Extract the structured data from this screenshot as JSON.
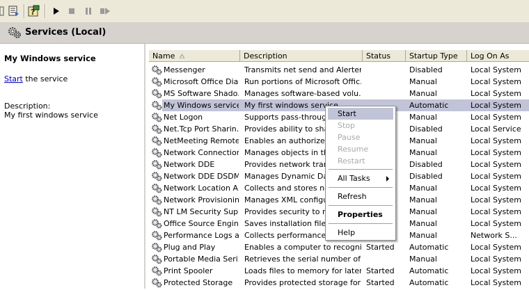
{
  "header": {
    "title": "Services (Local)"
  },
  "left_pane": {
    "service_name": "My Windows service",
    "start_link": "Start",
    "start_suffix": " the service",
    "description_label": "Description:",
    "description_value": "My first windows service"
  },
  "columns": [
    "Name",
    "Description",
    "Status",
    "Startup Type",
    "Log On As"
  ],
  "rows": [
    {
      "name": "Messenger",
      "desc": "Transmits net send and Alerter ...",
      "status": "",
      "type": "Disabled",
      "logon": "Local System"
    },
    {
      "name": "Microsoft Office Dia...",
      "desc": "Run portions of Microsoft Offic...",
      "status": "",
      "type": "Manual",
      "logon": "Local System"
    },
    {
      "name": "MS Software Shado...",
      "desc": "Manages software-based volu...",
      "status": "",
      "type": "Manual",
      "logon": "Local System"
    },
    {
      "name": "My Windows service",
      "desc": "My first windows service",
      "status": "",
      "type": "Automatic",
      "logon": "Local System"
    },
    {
      "name": "Net Logon",
      "desc": "Supports pass-through a",
      "status": "",
      "type": "Manual",
      "logon": "Local System"
    },
    {
      "name": "Net.Tcp Port Sharin...",
      "desc": "Provides ability to share",
      "status": "",
      "type": "Disabled",
      "logon": "Local Service"
    },
    {
      "name": "NetMeeting Remote...",
      "desc": "Enables an authorized u",
      "status": "",
      "type": "Manual",
      "logon": "Local System"
    },
    {
      "name": "Network Connections",
      "desc": "Manages objects in the I",
      "status": "",
      "type": "Manual",
      "logon": "Local System"
    },
    {
      "name": "Network DDE",
      "desc": "Provides network transp",
      "status": "",
      "type": "Disabled",
      "logon": "Local System"
    },
    {
      "name": "Network DDE DSDM",
      "desc": "Manages Dynamic Data",
      "status": "",
      "type": "Disabled",
      "logon": "Local System"
    },
    {
      "name": "Network Location A...",
      "desc": "Collects and stores netw",
      "status": "",
      "type": "Manual",
      "logon": "Local System"
    },
    {
      "name": "Network Provisionin...",
      "desc": "Manages XML configurat",
      "status": "",
      "type": "Manual",
      "logon": "Local System"
    },
    {
      "name": "NT LM Security Sup...",
      "desc": "Provides security to rem",
      "status": "",
      "type": "Manual",
      "logon": "Local System"
    },
    {
      "name": "Office Source Engine",
      "desc": "Saves installation files u",
      "status": "",
      "type": "Manual",
      "logon": "Local System"
    },
    {
      "name": "Performance Logs a...",
      "desc": "Collects performance da",
      "status": "",
      "type": "Manual",
      "logon": "Network S..."
    },
    {
      "name": "Plug and Play",
      "desc": "Enables a computer to recogniz...",
      "status": "Started",
      "type": "Automatic",
      "logon": "Local System"
    },
    {
      "name": "Portable Media Seri...",
      "desc": "Retrieves the serial number of ...",
      "status": "",
      "type": "Manual",
      "logon": "Local System"
    },
    {
      "name": "Print Spooler",
      "desc": "Loads files to memory for later ...",
      "status": "Started",
      "type": "Automatic",
      "logon": "Local System"
    },
    {
      "name": "Protected Storage",
      "desc": "Provides protected storage for ...",
      "status": "Started",
      "type": "Automatic",
      "logon": "Local System"
    }
  ],
  "context_menu": {
    "start": "Start",
    "stop": "Stop",
    "pause": "Pause",
    "resume": "Resume",
    "restart": "Restart",
    "all_tasks": "All Tasks",
    "refresh": "Refresh",
    "properties": "Properties",
    "help": "Help"
  },
  "colors": {
    "selection": "#c1c4d8",
    "link": "#0000cc",
    "chrome": "#ece9d8"
  }
}
